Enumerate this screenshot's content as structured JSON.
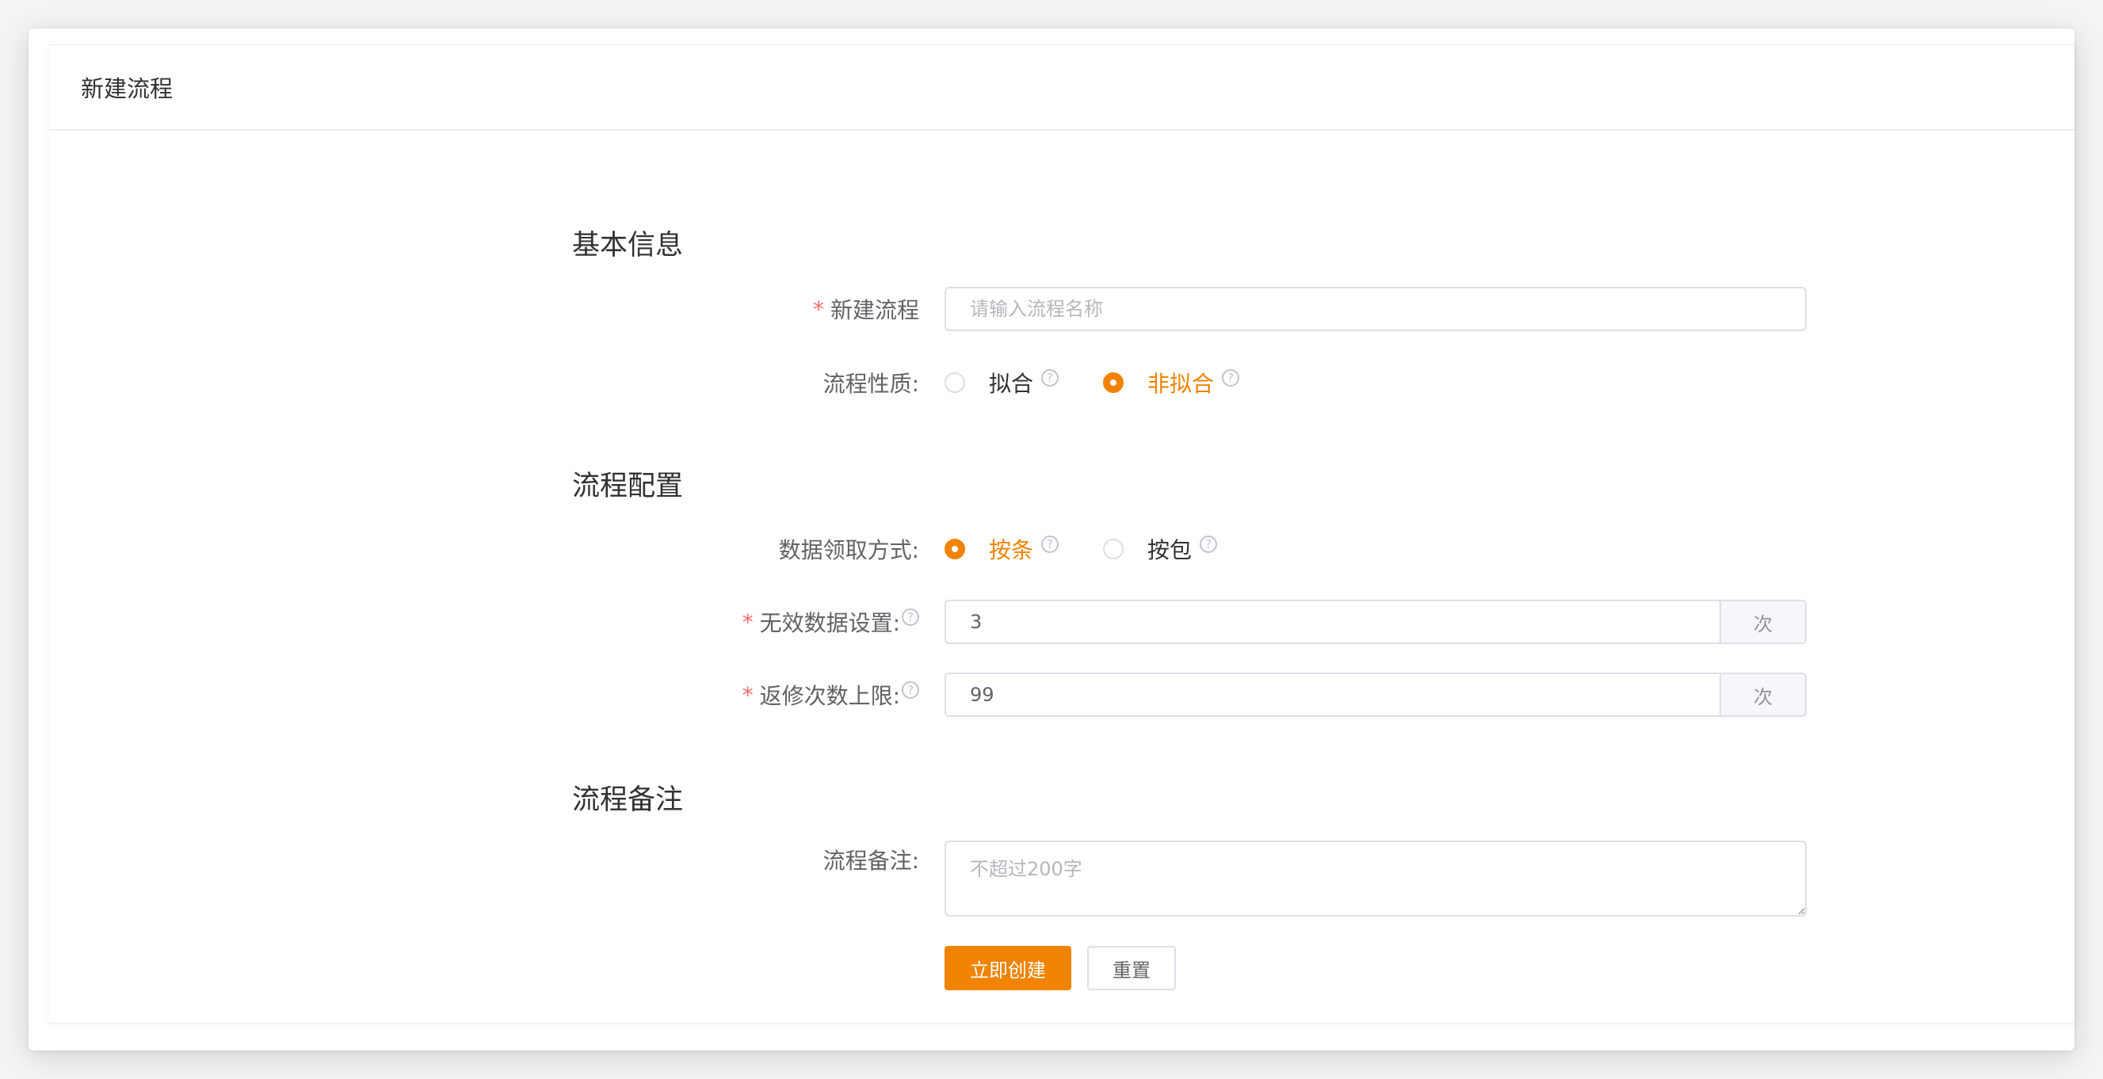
{
  "header": {
    "title": "新建流程"
  },
  "sections": {
    "basic": "基本信息",
    "config": "流程配置",
    "remark": "流程备注"
  },
  "fields": {
    "name": {
      "label": "新建流程",
      "required": "*",
      "placeholder": "请输入流程名称",
      "value": ""
    },
    "nature": {
      "label": "流程性质:",
      "options": [
        {
          "label": "拟合",
          "checked": false
        },
        {
          "label": "非拟合",
          "checked": true
        }
      ]
    },
    "fetch_mode": {
      "label": "数据领取方式:",
      "options": [
        {
          "label": "按条",
          "checked": true
        },
        {
          "label": "按包",
          "checked": false
        }
      ]
    },
    "invalid": {
      "label": "无效数据设置:",
      "required": "*",
      "value": "3",
      "append": "次"
    },
    "rework": {
      "label": "返修次数上限:",
      "required": "*",
      "value": "99",
      "append": "次"
    },
    "remark": {
      "label": "流程备注:",
      "placeholder": "不超过200字",
      "value": ""
    }
  },
  "buttons": {
    "submit": "立即创建",
    "reset": "重置"
  },
  "icons": {
    "help": "?"
  },
  "colors": {
    "accent": "#f08300",
    "required": "#f56c6c"
  }
}
